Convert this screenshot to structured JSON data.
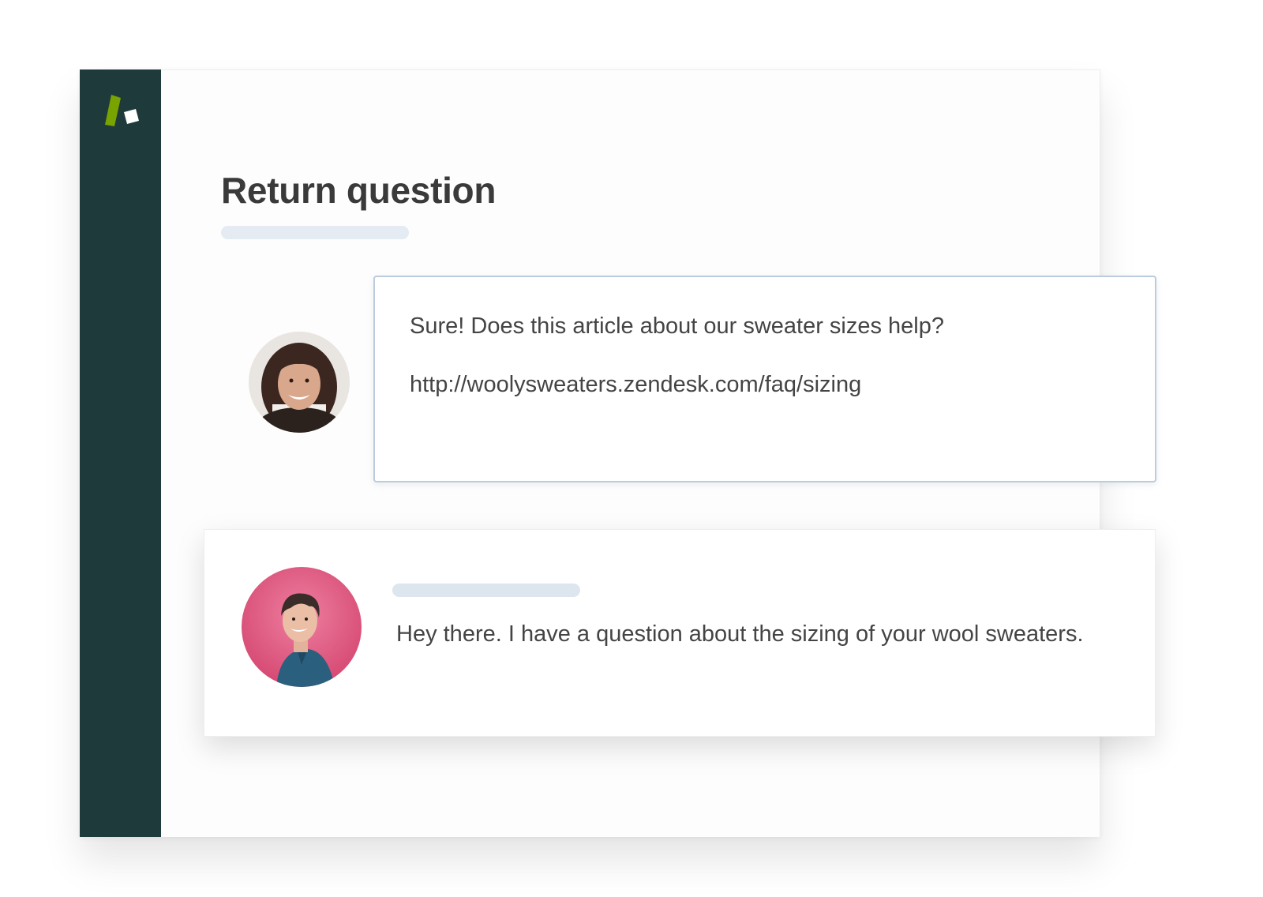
{
  "ticket": {
    "title": "Return question"
  },
  "agent_message": {
    "text": "Sure! Does this article about our sweater sizes help?",
    "link": "http://woolysweaters.zendesk.com/faq/sizing"
  },
  "customer_message": {
    "text": "Hey there. I have a question about the sizing of your wool sweaters."
  },
  "colors": {
    "sidebar": "#1f3a3a",
    "logo_green": "#78a300",
    "bubble_border": "#bdccdd",
    "placeholder_bar": "#e4ebf2",
    "customer_avatar_bg": "#e0507a"
  },
  "icons": {
    "logo": "zendesk-logo-icon"
  }
}
